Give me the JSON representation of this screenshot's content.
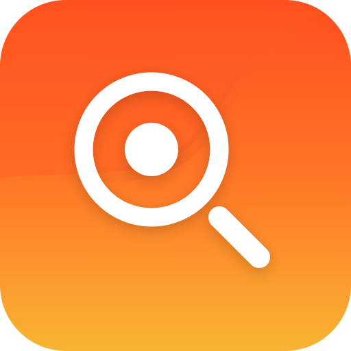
{
  "app_icon": {
    "icon_name": "magnifying-glass-icon",
    "colors": {
      "gradient_top": "#FF4D1E",
      "gradient_mid": "#FF7A27",
      "gradient_bottom": "#F8B532",
      "glyph": "#FFFFFF",
      "fold_shadow": "#E3541D",
      "fold_highlight": "#FF6A2A"
    }
  }
}
